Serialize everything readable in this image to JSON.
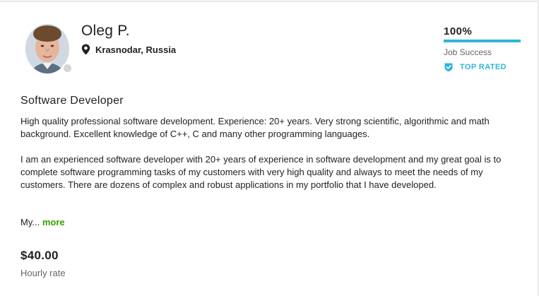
{
  "profile": {
    "name": "Oleg P.",
    "location": "Krasnodar, Russia",
    "location_icon": "map-pin-icon",
    "avatar_alt": "profile photo"
  },
  "job_success": {
    "value": "100%",
    "fraction": 1.0,
    "label": "Job Success",
    "bar_color": "#30b6d8"
  },
  "badge": {
    "label": "TOP RATED",
    "icon": "shield-badge-icon",
    "color": "#30b6d8"
  },
  "title": "Software Developer",
  "description": {
    "paragraph_1": "High quality professional software development. Experience: 20+ years. Very strong scientific, algorithmic and math background. Excellent knowledge of C++, C and many other programming languages.",
    "paragraph_2": "I am an experienced software developer with 20+ years of experience in software development and my great goal is to complete software programming tasks of my customers with very high quality and always to meet the needs of my customers. There are dozens of complex and robust applications in my portfolio that I have developed.",
    "teaser": "My...",
    "more_label": "more"
  },
  "rate": {
    "amount": "$40.00",
    "label": "Hourly rate"
  },
  "colors": {
    "accent_blue": "#30b6d8",
    "link_green": "#37a000",
    "status_offline": "#d6d6d6"
  }
}
